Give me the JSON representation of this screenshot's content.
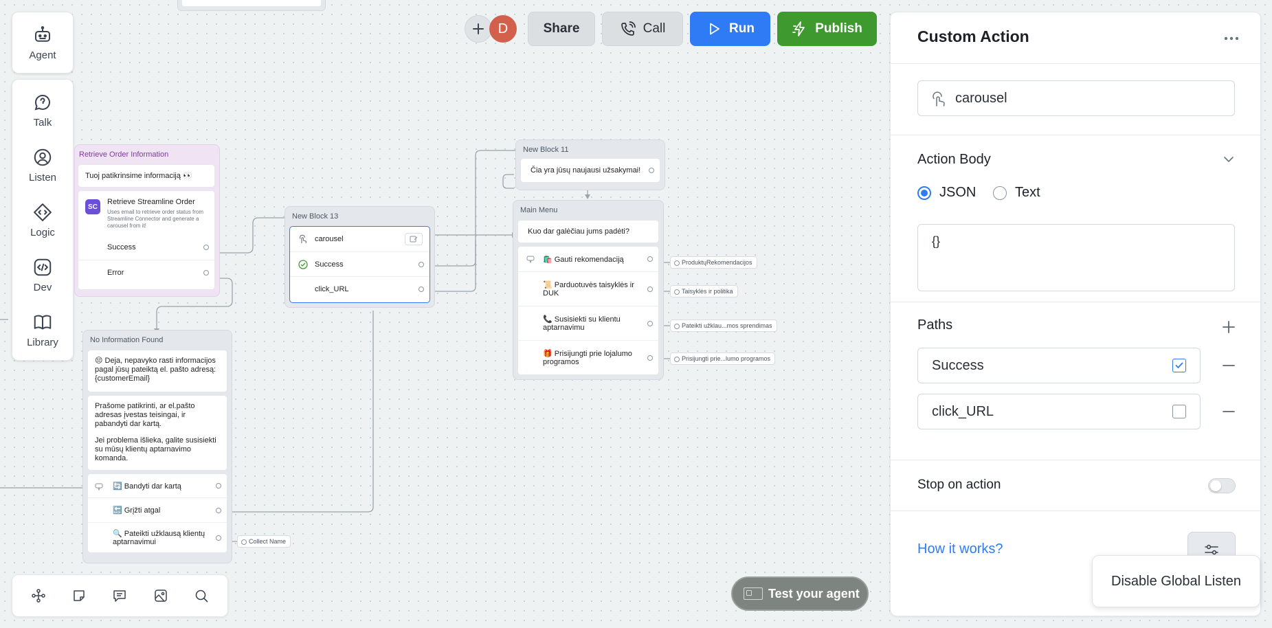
{
  "rail_top": {
    "agent_label": "Agent"
  },
  "rail_main": [
    {
      "label": "Talk",
      "icon": "talk-icon"
    },
    {
      "label": "Listen",
      "icon": "listen-icon"
    },
    {
      "label": "Logic",
      "icon": "logic-icon"
    },
    {
      "label": "Dev",
      "icon": "dev-icon"
    },
    {
      "label": "Library",
      "icon": "library-icon"
    }
  ],
  "header": {
    "avatar_initial": "D",
    "share_label": "Share",
    "call_label": "Call",
    "run_label": "Run",
    "publish_label": "Publish",
    "colors": {
      "run": "#2f7bf5",
      "publish": "#3e9a2f"
    }
  },
  "canvas": {
    "retrieve_block": {
      "title": "Retrieve Order Information",
      "message": "Tuoj patikrinsime informaciją 👀",
      "integration_title": "Retrieve Streamline Order",
      "integration_badge": "SC",
      "integration_desc": "Uses email to retrieve order status from Streamline Connector and generate a carousel from it!",
      "paths": [
        "Success",
        "Error"
      ]
    },
    "no_info_block": {
      "title": "No Information Found",
      "message1": "😔 Deja, nepavyko rasti informacijos pagal jūsų pateiktą el. pašto adresą:{customerEmail}",
      "message2a": "Prašome patikrinti, ar el.pašto adresas įvestas teisingai, ir pabandyti dar kartą.",
      "message2b": "Jei problema išlieka, galite susisiekti su mūsų klientų aptarnavimo komanda.",
      "buttons": [
        "🔄 Bandyti dar kartą",
        "🔙 Grįžti atgal",
        "🔍 Pateikti užklausą klientų aptarnavimui"
      ],
      "chip": "Collect Name"
    },
    "block13": {
      "title": "New Block 13",
      "rows": [
        "carousel",
        "Success",
        "click_URL"
      ]
    },
    "block11": {
      "title": "New Block 11",
      "message": "Čia yra jūsų naujausi užsakymai!"
    },
    "main_menu": {
      "title": "Main Menu",
      "message": "Kuo dar galėčiau jums padėti?",
      "buttons": [
        "🛍️ Gauti rekomendaciją",
        "📜 Parduotuvės taisyklės ir DUK",
        "📞 Susisiekti su klientu aptarnavimu",
        "🎁 Prisijungti prie lojalumo programos"
      ],
      "chips": [
        "ProduktųRekomendacijos",
        "Taisyklės ir politika",
        "Pateikti užklau...mos sprendimas",
        "Prisijungti prie...lumo programos"
      ]
    },
    "test_agent_label": "Test your agent"
  },
  "panel": {
    "title": "Custom Action",
    "action_name": "carousel",
    "action_body_label": "Action Body",
    "format_options": [
      "JSON",
      "Text"
    ],
    "format_selected": "JSON",
    "body_value": "{}",
    "paths_label": "Paths",
    "paths": [
      {
        "name": "Success",
        "checked": true
      },
      {
        "name": "click_URL",
        "checked": false
      }
    ],
    "stop_on_action_label": "Stop on action",
    "stop_on_action": false,
    "how_it_works_label": "How it works?",
    "accent": "#2f7bf5"
  },
  "popover": {
    "label": "Disable Global Listen"
  }
}
